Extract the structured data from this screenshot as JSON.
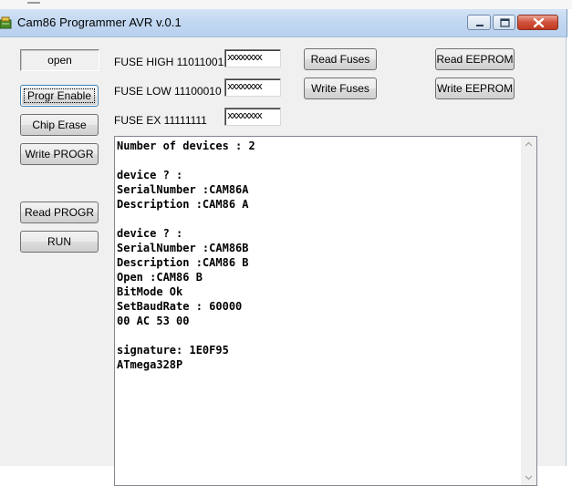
{
  "window": {
    "title": "Cam86 Programmer AVR v.0.1",
    "icon": "app-icon",
    "controls": [
      "minimize-icon",
      "maximize-icon",
      "close-icon"
    ]
  },
  "left_buttons": {
    "open": "open",
    "progr_enable": "Progr Enable",
    "chip_erase": "Chip Erase",
    "write_progr": "Write PROGR",
    "read_progr": "Read PROGR",
    "run": "RUN"
  },
  "fuses": {
    "high_label": "FUSE HIGH 11011001",
    "high_value": "xxxxxxxx",
    "low_label": "FUSE LOW 11100010",
    "low_value": "xxxxxxxx",
    "ex_label": "FUSE EX 11111111",
    "ex_value": "xxxxxxxx",
    "read_button": "Read Fuses",
    "write_button": "Write Fuses"
  },
  "eeprom": {
    "read_button": "Read EEPROM",
    "write_button": "Write EEPROM"
  },
  "log": {
    "text": "Number of devices : 2\n\ndevice ? :\nSerialNumber :CAM86A\nDescription :CAM86 A\n\ndevice ? :\nSerialNumber :CAM86B\nDescription :CAM86 B\nOpen :CAM86 B\nBitMode Ok\nSetBaudRate : 60000\n00 AC 53 00\n\nsignature: 1E0F95\nATmega328P"
  },
  "colors": {
    "titlebar": "#c3d8f1",
    "close_button": "#c9462c",
    "dialog_background": "#f0f0f0"
  }
}
